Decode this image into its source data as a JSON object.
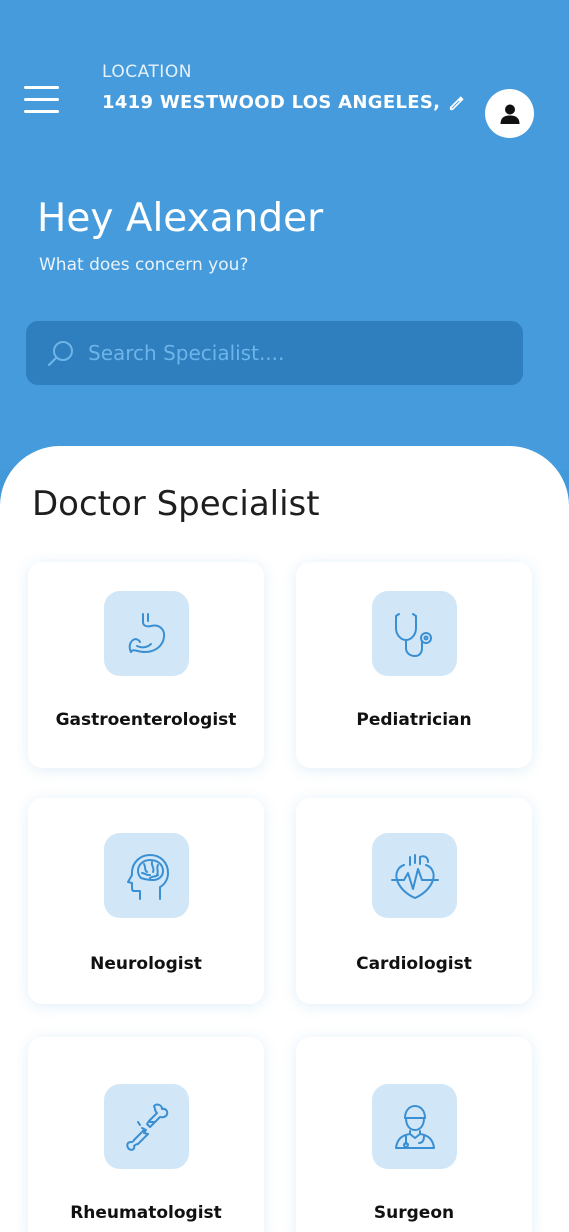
{
  "header": {
    "location_label": "LOCATION",
    "location_value": "1419 WESTWOOD LOS ANGELES,",
    "greeting": "Hey Alexander",
    "subtitle": "What does concern you?"
  },
  "search": {
    "placeholder": "Search Specialist...."
  },
  "section": {
    "title": "Doctor Specialist"
  },
  "specialists": [
    {
      "label": "Gastroenterologist",
      "icon": "stomach-icon"
    },
    {
      "label": "Pediatrician",
      "icon": "stethoscope-icon"
    },
    {
      "label": "Neurologist",
      "icon": "brain-head-icon"
    },
    {
      "label": "Cardiologist",
      "icon": "heart-icon"
    },
    {
      "label": "Rheumatologist",
      "icon": "broken-bone-icon"
    },
    {
      "label": "Surgeon",
      "icon": "doctor-icon"
    }
  ],
  "colors": {
    "primary": "#459bdb",
    "search_bg": "#2f7fbf",
    "tile_bg": "#d1e7f8",
    "icon_stroke": "#3a8fd2"
  }
}
